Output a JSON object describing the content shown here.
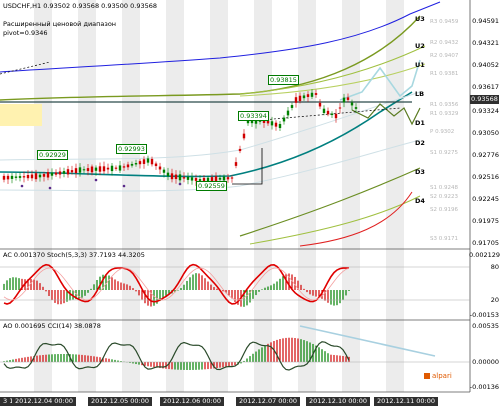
{
  "chart": {
    "symbol": "USDCHF,H1",
    "ohlc": [
      "0.93502",
      "0.93568",
      "0.93500",
      "0.93568"
    ],
    "comment_line1": "Расширенный ценовой диапазон",
    "comment_line2": "pivot=0.9346",
    "current_price": "0.93568"
  },
  "price_axis": [
    "0.94591",
    "0.94321",
    "0.94052",
    "0.93617",
    "0.93568",
    "0.93324",
    "0.93050",
    "0.92776",
    "0.92516",
    "0.92245",
    "0.91975",
    "0.91705"
  ],
  "level_tags": [
    "U3",
    "U2",
    "U1",
    "LB",
    "D1",
    "D2",
    "D3",
    "D4"
  ],
  "ghost_labels": [
    "R3 0.9459",
    "R2 0.9432",
    "R2 0.9407",
    "R1 0.9381",
    "R1 0.9356",
    "R1 0.9329",
    "P 0.9302",
    "S1 0.9275",
    "S1 0.9248",
    "S2 0.9223",
    "S2 0.9196",
    "S3 0.9171"
  ],
  "price_flags": [
    "0.92929",
    "0.92993",
    "0.92559",
    "0.93394",
    "0.93815"
  ],
  "ac_pane": {
    "header": "AC 0.001370  Stoch(5,3,3) 37.7193 44.3205",
    "ticks": [
      "0.002129",
      "80",
      "20",
      "-0.00153"
    ]
  },
  "ao_pane": {
    "header": "AO 0.001695  CCI(14) 38.0878",
    "ticks": [
      "0.00535",
      "0.00000",
      "-0.00136"
    ]
  },
  "time_axis": [
    "3 12",
    "2012.12.04 00:00",
    "2012.12.05 00:00",
    "2012.12.06 00:00",
    "2012.12.07 00:00",
    "2012.12.10 00:00",
    "2012.12.11 00:00"
  ],
  "logo": "alpari",
  "colors": {
    "bull_candle": "#008000",
    "bear_candle": "#d00000",
    "stochastic": "#e00000",
    "ma_teal": "#007f7f",
    "ma_olive": "#6b8e23",
    "envelope_blue": "#2020e0",
    "envelope_red": "#e02020",
    "forecast": "#a8d8e0"
  },
  "icons": {
    "logo": "alpari-logo-icon"
  }
}
